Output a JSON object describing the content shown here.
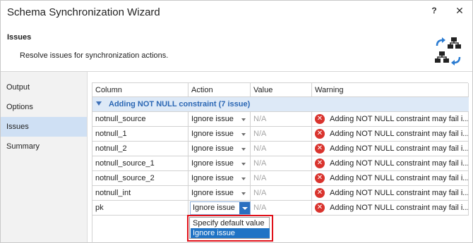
{
  "window": {
    "title": "Schema Synchronization Wizard",
    "help_label": "?",
    "close_label": "✕"
  },
  "header": {
    "title": "Issues",
    "description": "Resolve issues for synchronization actions."
  },
  "sidebar": {
    "items": [
      {
        "label": "Output",
        "active": false
      },
      {
        "label": "Options",
        "active": false
      },
      {
        "label": "Issues",
        "active": true
      },
      {
        "label": "Summary",
        "active": false
      }
    ]
  },
  "grid": {
    "columns": [
      "Column",
      "Action",
      "Value",
      "Warning"
    ],
    "group_label": "Adding NOT NULL constraint (7 issue)",
    "rows": [
      {
        "column": "notnull_source",
        "action": "Ignore issue",
        "value": "N/A",
        "warning": "Adding NOT NULL constraint may fail i..."
      },
      {
        "column": "notnull_1",
        "action": "Ignore issue",
        "value": "N/A",
        "warning": "Adding NOT NULL constraint may fail i..."
      },
      {
        "column": "notnull_2",
        "action": "Ignore issue",
        "value": "N/A",
        "warning": "Adding NOT NULL constraint may fail i..."
      },
      {
        "column": "notnull_source_1",
        "action": "Ignore issue",
        "value": "N/A",
        "warning": "Adding NOT NULL constraint may fail i..."
      },
      {
        "column": "notnull_source_2",
        "action": "Ignore issue",
        "value": "N/A",
        "warning": "Adding NOT NULL constraint may fail i..."
      },
      {
        "column": "notnull_int",
        "action": "Ignore issue",
        "value": "N/A",
        "warning": "Adding NOT NULL constraint may fail i..."
      },
      {
        "column": "pk",
        "action": "Ignore issue",
        "value": "N/A",
        "warning": "Adding NOT NULL constraint may fail i..."
      }
    ]
  },
  "dropdown": {
    "options": [
      "Specify default value",
      "Ignore issue"
    ],
    "selected": "Ignore issue"
  },
  "colors": {
    "accent": "#1f73c5",
    "group_bg": "#dde9f7",
    "group_text": "#2b67b4",
    "error": "#d9332d",
    "highlight_outline": "#e0111a"
  }
}
